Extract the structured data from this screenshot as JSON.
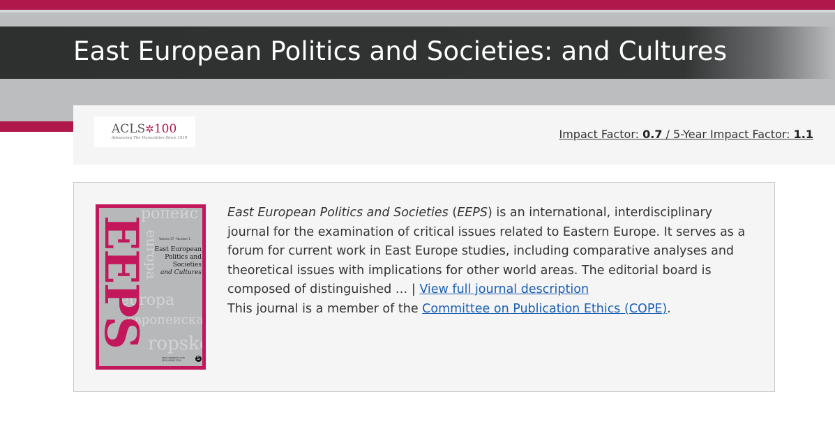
{
  "header": {
    "title": "East European Politics and Societies: and Cultures"
  },
  "metrics": {
    "acls_logo": {
      "name": "ACLS",
      "number": "100",
      "tagline": "Advancing The Humanities Since 1919"
    },
    "impact_factor_label": "Impact Factor:",
    "impact_factor_value": "0.7",
    "separator": "/",
    "five_year_label": "5-Year Impact Factor:",
    "five_year_value": "1.1"
  },
  "description": {
    "journal_name_italic": "East European Politics and Societies",
    "abbrev_open": " (",
    "abbrev": "EEPS",
    "body": ") is an international, interdisciplinary journal for the examination of critical issues related to Eastern Europe. It serves as a forum for current work in East Europe studies, including comparative analyses and theoretical issues with implications for other world areas. The editorial board is composed of distinguished … | ",
    "full_description_link": "View full journal description",
    "cope_prefix": "This journal is a member of the ",
    "cope_link": "Committee on Publication Ethics (COPE)",
    "cope_suffix": "."
  },
  "cover": {
    "big_letters": "EEPS",
    "title_line1": "East European",
    "title_line2": "Politics and Societies",
    "title_line3": "and Cultures",
    "publisher_mark": "S"
  },
  "colors": {
    "brand_crimson": "#b0174a",
    "title_bar": "#333535",
    "band_grey": "#bcbdbf",
    "link": "#1a5fb4"
  }
}
